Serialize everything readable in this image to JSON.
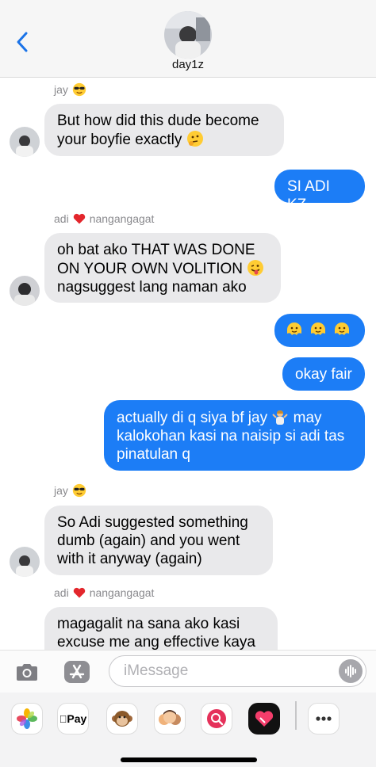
{
  "header": {
    "contact_name": "day1z"
  },
  "messages": [
    {
      "type": "sender",
      "name": "jay",
      "emoji": "sunglasses"
    },
    {
      "type": "incoming",
      "text": "But how did this dude become your boyfie exactly",
      "emoji": "thinking-face"
    },
    {
      "type": "outgoing",
      "text": "SI ADI KZ"
    },
    {
      "type": "sender",
      "name": "adi",
      "emoji": "red-heart",
      "extra": "nangangagat"
    },
    {
      "type": "incoming",
      "text": "oh bat ako THAT WAS DONE ON YOUR OWN VOLITION",
      "emoji": "tongue-face",
      "text2": "nagsuggest lang naman ako"
    },
    {
      "type": "outgoing",
      "emojis": [
        "melting-face",
        "melting-face",
        "melting-face"
      ]
    },
    {
      "type": "outgoing",
      "text": "okay fair"
    },
    {
      "type": "outgoing",
      "text": "actually di q siya bf jay",
      "emoji": "shrugging-person",
      "text2": "may kalokohan kasi na naisip si adi tas pinatulan q"
    },
    {
      "type": "sender",
      "name": "jay",
      "emoji": "sunglasses"
    },
    {
      "type": "incoming",
      "text": "So Adi suggested something dumb (again) and you went with it anyway (again)"
    },
    {
      "type": "sender",
      "name": "adi",
      "emoji": "red-heart",
      "extra": "nangangagat"
    },
    {
      "type": "incoming",
      "text": "magagalit na sana ako kasi excuse me ang effective kaya"
    }
  ],
  "input": {
    "placeholder": "iMessage"
  },
  "app_drawer": {
    "apple_pay_label": "Pay"
  },
  "colors": {
    "outgoing_bubble": "#1c7df6",
    "incoming_bubble": "#e9e9eb",
    "ios_blue": "#1a73e8",
    "sender_gray": "#8a8a8e"
  }
}
